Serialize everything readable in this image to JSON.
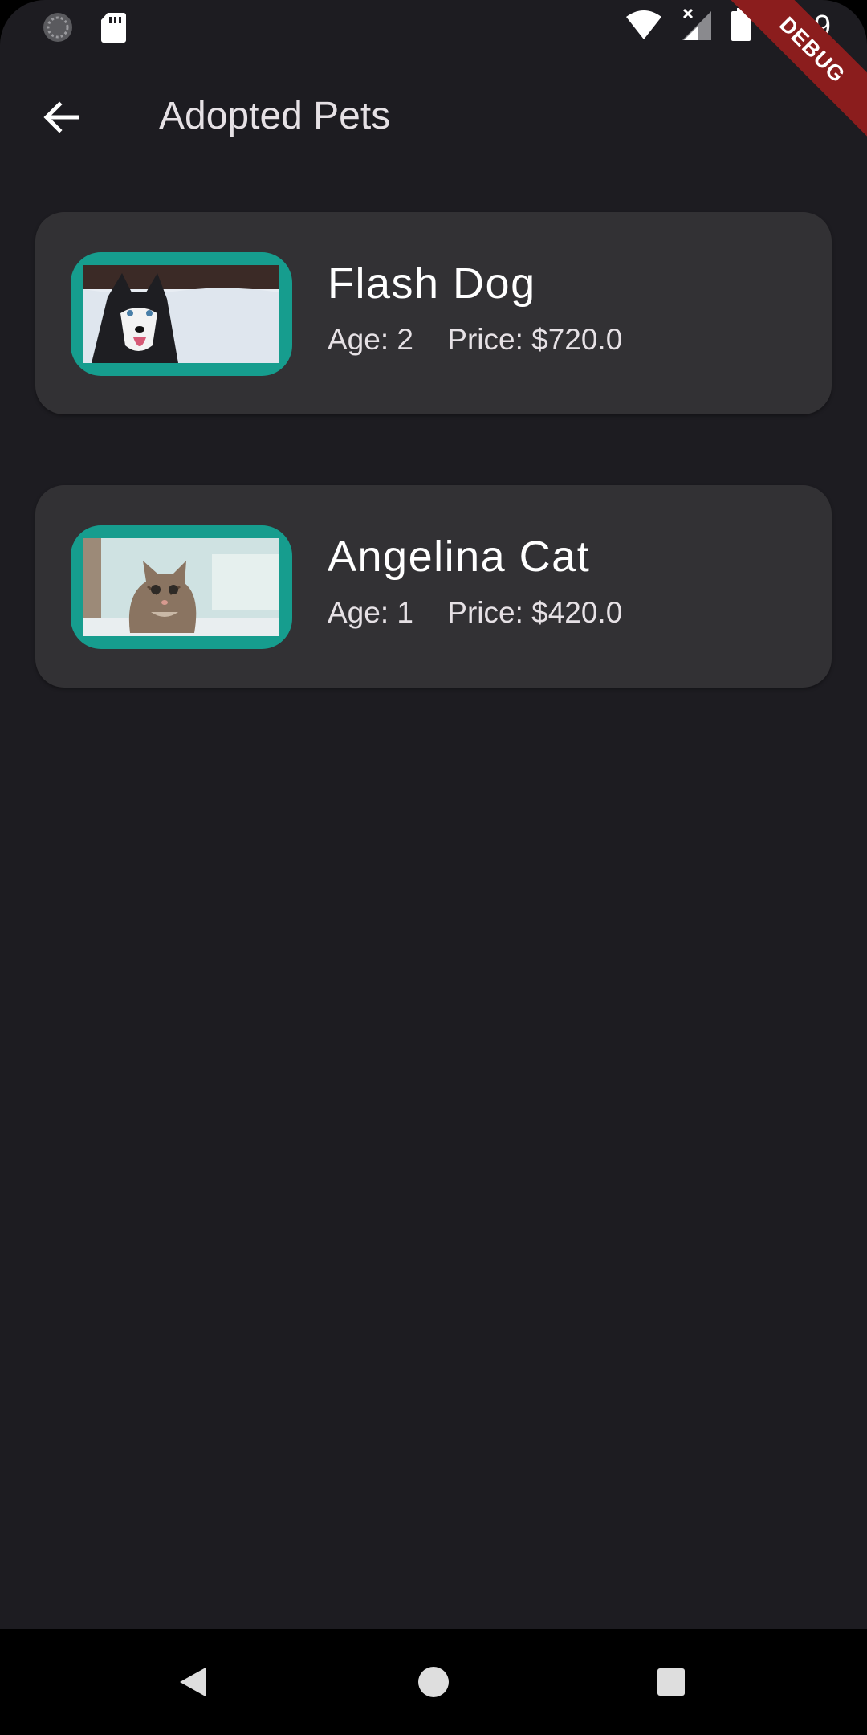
{
  "status_bar": {
    "time": "7:39",
    "icons": [
      "sync-icon",
      "sd-card-icon",
      "wifi-icon",
      "signal-icon",
      "battery-icon"
    ]
  },
  "debug_banner": "DEBUG",
  "app_bar": {
    "back_icon": "arrow-back-icon",
    "title": "Adopted Pets"
  },
  "pets": [
    {
      "name": "Flash Dog",
      "age": "Age: 2",
      "price": "Price: $720.0",
      "photo": "husky-dog-photo"
    },
    {
      "name": "Angelina Cat",
      "age": "Age: 1",
      "price": "Price: $420.0",
      "photo": "tabby-kitten-photo"
    }
  ],
  "nav_bar": {
    "buttons": [
      "back-triangle-icon",
      "home-circle-icon",
      "recents-square-icon"
    ]
  },
  "colors": {
    "background": "#1d1c21",
    "card": "#323134",
    "photo_frame": "#169d8e",
    "debug_banner": "#8b1d1d"
  }
}
